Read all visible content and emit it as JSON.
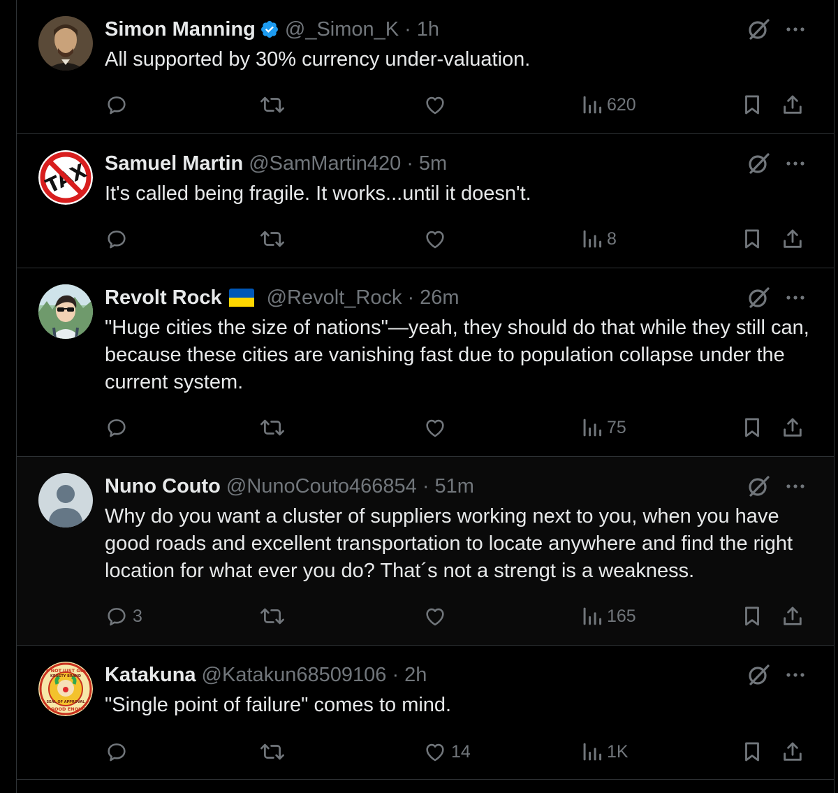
{
  "tweets": [
    {
      "name": "Simon Manning",
      "verified": true,
      "handle": "@_Simon_K",
      "time": "1h",
      "text": "All supported by 30% currency under-valuation.",
      "replies": "",
      "likes": "",
      "views": "620"
    },
    {
      "name": "Samuel Martin",
      "handle": "@SamMartin420",
      "time": "5m",
      "text": "It's called being fragile. It works...until it doesn't.",
      "replies": "",
      "likes": "",
      "views": "8",
      "avatar_text": "TAX"
    },
    {
      "name": "Revolt Rock",
      "flag": "ukraine-flag",
      "handle": "@Revolt_Rock",
      "time": "26m",
      "text": "\"Huge cities the size of nations\"—yeah, they should do that while they still can, because these cities are vanishing fast due to population collapse under the current system.",
      "replies": "",
      "likes": "",
      "views": "75"
    },
    {
      "name": "Nuno Couto",
      "handle": "@NunoCouto466854",
      "time": "51m",
      "text": "Why do you want a cluster of suppliers working next to you, when you have good roads and excellent transportation to locate anywhere and find the right location for what ever you do? That´s not a strengt is a weakness.",
      "replies": "3",
      "likes": "",
      "views": "165"
    },
    {
      "name": "Katakuna",
      "handle": "@Katakun68509106",
      "time": "2h",
      "text": "\"Single point of failure\" comes to mind.",
      "replies": "",
      "likes": "14",
      "views": "1K",
      "avatar_text": [
        "IT'S NOT JUST GOOD",
        "KRUSTY BRAND",
        "SEAL OF APPROVAL",
        "IT'S GOOD ENOUGH!"
      ]
    }
  ],
  "separator": "·",
  "colors": {
    "background": "#000000",
    "text": "#e7e9ea",
    "secondary": "#71767b",
    "border": "#2f3336",
    "verified": "#1d9bf0"
  }
}
